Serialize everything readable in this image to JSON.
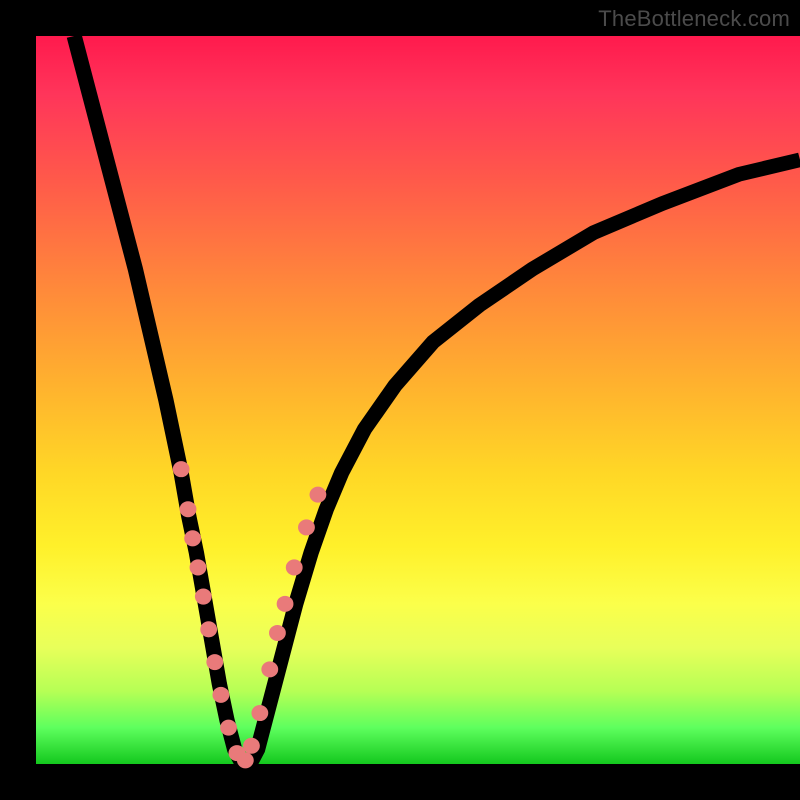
{
  "watermark": "TheBottleneck.com",
  "colors": {
    "dot": "#e97a7a",
    "curve": "#000000",
    "frame": "#000000"
  },
  "chart_data": {
    "type": "line",
    "title": "",
    "xlabel": "",
    "ylabel": "",
    "xlim": [
      0,
      100
    ],
    "ylim": [
      0,
      100
    ],
    "notes": "Bottleneck-style V curve. Axes are implicit percent scales; no tick labels are rendered. Values are estimated from pixel positions.",
    "series": [
      {
        "name": "bottleneck-curve",
        "x": [
          5,
          7,
          9,
          11,
          13,
          15,
          17,
          19,
          20,
          21,
          22,
          23,
          24,
          25,
          26,
          27,
          28,
          29,
          30,
          32,
          34,
          36,
          38,
          40,
          43,
          47,
          52,
          58,
          65,
          73,
          82,
          92,
          100
        ],
        "y": [
          100,
          92,
          84,
          76,
          68,
          59,
          50,
          40,
          34,
          29,
          23,
          17,
          11,
          6,
          2,
          0,
          0,
          2,
          6,
          14,
          22,
          29,
          35,
          40,
          46,
          52,
          58,
          63,
          68,
          73,
          77,
          81,
          83
        ]
      }
    ],
    "points": {
      "name": "sample-dots",
      "note": "Salmon dots clustered on both arms of the V near its minimum.",
      "x": [
        19.0,
        19.9,
        20.5,
        21.2,
        21.9,
        22.6,
        23.4,
        24.2,
        25.2,
        26.3,
        27.4,
        28.2,
        29.3,
        30.6,
        31.6,
        32.6,
        33.8,
        35.4,
        36.9
      ],
      "y": [
        40.5,
        35.0,
        31.0,
        27.0,
        23.0,
        18.5,
        14.0,
        9.5,
        5.0,
        1.5,
        0.5,
        2.5,
        7.0,
        13.0,
        18.0,
        22.0,
        27.0,
        32.5,
        37.0
      ]
    }
  }
}
